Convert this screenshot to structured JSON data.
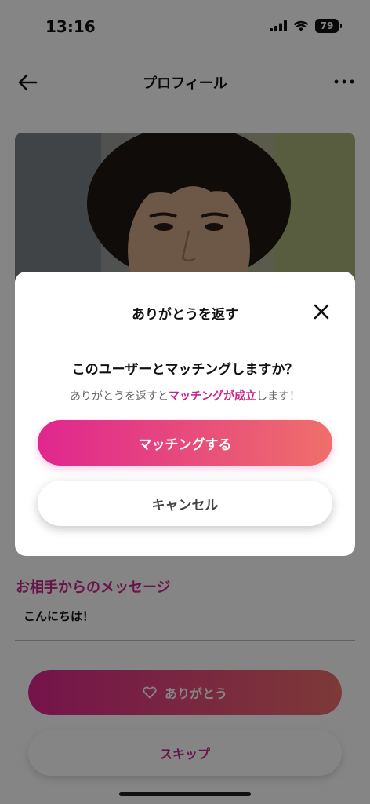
{
  "status_bar": {
    "time": "13:16",
    "battery": "79"
  },
  "header": {
    "title": "プロフィール"
  },
  "message": {
    "title": "お相手からのメッセージ",
    "text": "こんにちは！"
  },
  "actions": {
    "arigato_label": "ありがとう",
    "skip_label": "スキップ"
  },
  "modal": {
    "title": "ありがとうを返す",
    "question": "このユーザーとマッチングしますか？",
    "sub_prefix": "ありがとうを返すと",
    "sub_highlight": "マッチングが成立",
    "sub_suffix": "します！",
    "match_label": "マッチングする",
    "cancel_label": "キャンセル"
  },
  "colors": {
    "accent": "#c7278a",
    "gradient_start": "#e0268f",
    "gradient_end": "#ef6f6a"
  },
  "icons": [
    "signal-icon",
    "wifi-icon",
    "battery-icon",
    "back-arrow-icon",
    "more-icon",
    "close-icon",
    "heart-icon"
  ]
}
